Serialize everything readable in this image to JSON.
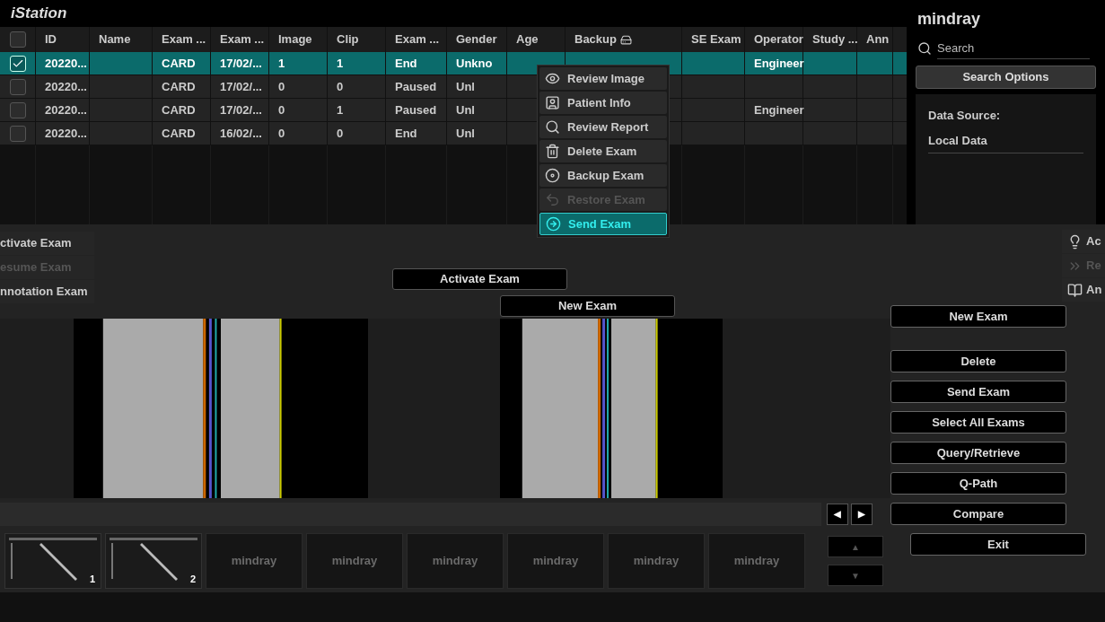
{
  "app": {
    "title": "iStation",
    "brand": "mindray"
  },
  "search": {
    "placeholder": "Search"
  },
  "search_options": {
    "label": "Search Options",
    "data_source_label": "Data Source:",
    "data_source": "Local Data"
  },
  "table": {
    "all_checked": false,
    "columns": [
      "ID",
      "Name",
      "Exam ...",
      "Exam ...",
      "Image",
      "Clip",
      "Exam ...",
      "Gender",
      "Age",
      "Backup",
      "SE Exam",
      "Operator",
      "Study ...",
      "Ann"
    ],
    "rows": [
      {
        "selected": true,
        "checked": true,
        "id": "20220...",
        "exam_type": "CARD",
        "exam_date": "17/02/...",
        "image": "1",
        "clip": "1",
        "exam_status": "End",
        "gender": "Unkno",
        "operator": "Engineer"
      },
      {
        "selected": false,
        "checked": false,
        "id": "20220...",
        "exam_type": "CARD",
        "exam_date": "17/02/...",
        "image": "0",
        "clip": "0",
        "exam_status": "Paused",
        "gender": "Unl"
      },
      {
        "selected": false,
        "checked": false,
        "id": "20220...",
        "exam_type": "CARD",
        "exam_date": "17/02/...",
        "image": "0",
        "clip": "1",
        "exam_status": "Paused",
        "gender": "Unl",
        "operator": "Engineer"
      },
      {
        "selected": false,
        "checked": false,
        "id": "20220...",
        "exam_type": "CARD",
        "exam_date": "16/02/...",
        "image": "0",
        "clip": "0",
        "exam_status": "End",
        "gender": "Unl"
      }
    ]
  },
  "context_menu": [
    {
      "kind": "eye",
      "label": "Review Image",
      "disabled": false,
      "selected": false
    },
    {
      "kind": "patient",
      "label": "Patient Info",
      "disabled": false,
      "selected": false
    },
    {
      "kind": "search",
      "label": "Review Report",
      "disabled": false,
      "selected": false
    },
    {
      "kind": "trash",
      "label": "Delete Exam",
      "disabled": false,
      "selected": false
    },
    {
      "kind": "disc",
      "label": "Backup Exam",
      "disabled": false,
      "selected": false
    },
    {
      "kind": "undo",
      "label": "Restore Exam",
      "disabled": true,
      "selected": false
    },
    {
      "kind": "send",
      "label": "Send Exam",
      "disabled": false,
      "selected": true
    }
  ],
  "left_menu": [
    {
      "label": "ctivate Exam",
      "disabled": false
    },
    {
      "label": "esume Exam",
      "disabled": true
    },
    {
      "label": "nnotation Exam",
      "disabled": false
    }
  ],
  "right_menu": [
    {
      "kind": "bulb",
      "label": "Ac",
      "disabled": false
    },
    {
      "kind": "arrows",
      "label": "Re",
      "disabled": true
    },
    {
      "kind": "book",
      "label": "An",
      "disabled": false
    }
  ],
  "dialog_buttons": [
    "Activate Exam",
    "New Exam"
  ],
  "side_buttons": [
    "New Exam",
    "Delete",
    "Send Exam",
    "Select All Exams",
    "Query/Retrieve",
    "Q-Path",
    "Compare"
  ],
  "exit_button": "Exit",
  "page_buttons": [
    {
      "label": "◀",
      "disabled": false
    },
    {
      "label": "▶",
      "disabled": false
    }
  ],
  "scroll_buttons": [
    {
      "label": "▲",
      "disabled": true
    },
    {
      "label": "▼",
      "disabled": true
    }
  ],
  "thumbnails": [
    {
      "label": "1"
    },
    {
      "label": "2"
    },
    {
      "kind": "placeholder",
      "label": "mindray"
    },
    {
      "kind": "placeholder",
      "label": "mindray"
    },
    {
      "kind": "placeholder",
      "label": "mindray"
    },
    {
      "kind": "placeholder",
      "label": "mindray"
    },
    {
      "kind": "placeholder",
      "label": "mindray"
    },
    {
      "kind": "placeholder",
      "label": "mindray"
    }
  ]
}
